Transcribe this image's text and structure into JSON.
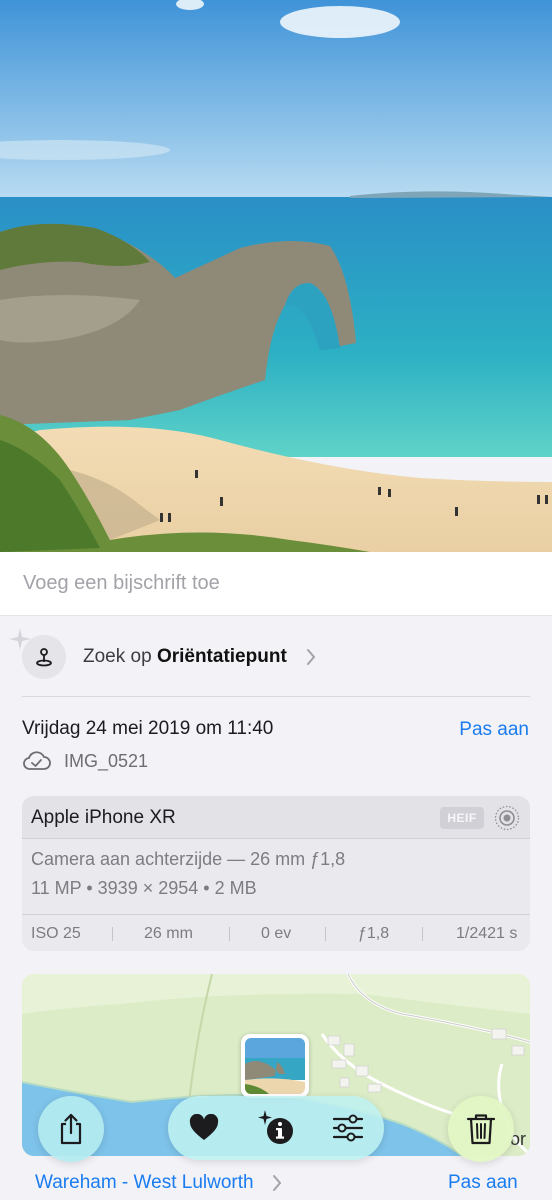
{
  "caption": {
    "placeholder": "Voeg een bijschrift toe"
  },
  "lookup": {
    "prefix": "Zoek op",
    "subject": "Oriëntatiepunt"
  },
  "meta": {
    "datetime": "Vrijdag 24 mei 2019 om 11:40",
    "edit_label": "Pas aan",
    "filename": "IMG_0521"
  },
  "device": {
    "name": "Apple iPhone XR",
    "format_badge": "HEIF",
    "lens": "Camera aan achterzijde — 26 mm ƒ1,8",
    "specs": "11 MP • 3939 × 2954 • 2 MB",
    "exif": {
      "iso": "ISO 25",
      "focal": "26 mm",
      "ev": "0 ev",
      "aperture": "ƒ1,8",
      "shutter": "1/2421 s"
    }
  },
  "map": {
    "partial_label": "or"
  },
  "location": {
    "name": "Wareham - West Lulworth",
    "edit_label": "Pas aan"
  },
  "toolbar": {
    "icons": [
      "share-icon",
      "heart-icon",
      "info-sparkle-icon",
      "adjust-icon",
      "trash-icon"
    ]
  },
  "colors": {
    "accent": "#1a7cf0",
    "background": "#f2f2f7"
  }
}
